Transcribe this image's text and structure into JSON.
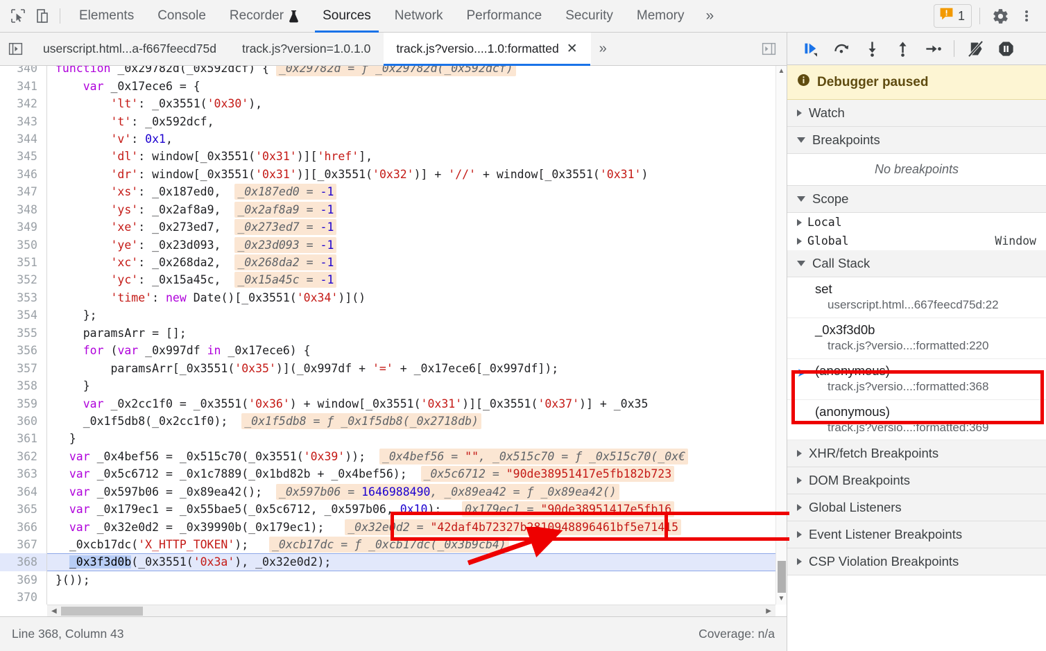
{
  "toolbar": {
    "inspect_icon": "inspect-cursor-icon",
    "device_icon": "device-toolbar-icon",
    "panels": [
      {
        "label": "Elements",
        "selected": false
      },
      {
        "label": "Console",
        "selected": false
      },
      {
        "label": "Recorder",
        "selected": false,
        "badge_icon": "flask-icon"
      },
      {
        "label": "Sources",
        "selected": true
      },
      {
        "label": "Network",
        "selected": false
      },
      {
        "label": "Performance",
        "selected": false
      },
      {
        "label": "Security",
        "selected": false
      },
      {
        "label": "Memory",
        "selected": false
      }
    ],
    "more_panels": "»",
    "warning_count": "1",
    "warning_icon": "warning-message-icon",
    "settings_icon": "gear-icon",
    "kebab_icon": "more-options-icon"
  },
  "file_tabs": {
    "nav_icon": "show-navigator-icon",
    "tabs": [
      {
        "label": "userscript.html...a-f667feecd75d",
        "active": false,
        "closable": false
      },
      {
        "label": "track.js?version=1.0.1.0",
        "active": false,
        "closable": false
      },
      {
        "label": "track.js?versio....1.0:formatted",
        "active": true,
        "closable": true,
        "close_glyph": "✕"
      }
    ],
    "more_glyph": "»",
    "right_panel_icon": "show-debugger-sidebar-icon"
  },
  "editor": {
    "first_line": 340,
    "exec_line": 368,
    "selected_token": "_0x3f3d0b",
    "lines": [
      {
        "n": 340,
        "clipped": true,
        "tokens": [
          {
            "t": "kw",
            "v": "function "
          },
          {
            "t": "fn",
            "v": "_0x29782d"
          },
          {
            "t": "pln",
            "v": "("
          },
          {
            "t": "pln",
            "v": "_0x592dcf"
          },
          {
            "t": "pln",
            "v": ") { "
          },
          {
            "t": "inline",
            "v": "_0x29782d = ƒ _0x29782d(_0x592dcf)"
          }
        ]
      },
      {
        "n": 341,
        "tokens": [
          {
            "t": "pln",
            "v": "    "
          },
          {
            "t": "kw",
            "v": "var"
          },
          {
            "t": "pln",
            "v": " _0x17ece6 = {"
          }
        ]
      },
      {
        "n": 342,
        "tokens": [
          {
            "t": "pln",
            "v": "        "
          },
          {
            "t": "str",
            "v": "'lt'"
          },
          {
            "t": "pln",
            "v": ": _0x3551("
          },
          {
            "t": "str",
            "v": "'0x30'"
          },
          {
            "t": "pln",
            "v": "),"
          }
        ]
      },
      {
        "n": 343,
        "tokens": [
          {
            "t": "pln",
            "v": "        "
          },
          {
            "t": "str",
            "v": "'t'"
          },
          {
            "t": "pln",
            "v": ": _0x592dcf,"
          }
        ]
      },
      {
        "n": 344,
        "tokens": [
          {
            "t": "pln",
            "v": "        "
          },
          {
            "t": "str",
            "v": "'v'"
          },
          {
            "t": "pln",
            "v": ": "
          },
          {
            "t": "num",
            "v": "0x1"
          },
          {
            "t": "pln",
            "v": ","
          }
        ]
      },
      {
        "n": 345,
        "tokens": [
          {
            "t": "pln",
            "v": "        "
          },
          {
            "t": "str",
            "v": "'dl'"
          },
          {
            "t": "pln",
            "v": ": window[_0x3551("
          },
          {
            "t": "str",
            "v": "'0x31'"
          },
          {
            "t": "pln",
            "v": ")]["
          },
          {
            "t": "str",
            "v": "'href'"
          },
          {
            "t": "pln",
            "v": "],"
          }
        ]
      },
      {
        "n": 346,
        "tokens": [
          {
            "t": "pln",
            "v": "        "
          },
          {
            "t": "str",
            "v": "'dr'"
          },
          {
            "t": "pln",
            "v": ": window[_0x3551("
          },
          {
            "t": "str",
            "v": "'0x31'"
          },
          {
            "t": "pln",
            "v": ")][_0x3551("
          },
          {
            "t": "str",
            "v": "'0x32'"
          },
          {
            "t": "pln",
            "v": ")] + "
          },
          {
            "t": "str",
            "v": "'//'"
          },
          {
            "t": "pln",
            "v": " + window[_0x3551("
          },
          {
            "t": "str",
            "v": "'0x31'"
          },
          {
            "t": "pln",
            "v": ")"
          }
        ]
      },
      {
        "n": 347,
        "tokens": [
          {
            "t": "pln",
            "v": "        "
          },
          {
            "t": "str",
            "v": "'xs'"
          },
          {
            "t": "pln",
            "v": ": _0x187ed0,  "
          },
          {
            "t": "inline",
            "v": "_0x187ed0 = ",
            "num": "-1"
          }
        ]
      },
      {
        "n": 348,
        "tokens": [
          {
            "t": "pln",
            "v": "        "
          },
          {
            "t": "str",
            "v": "'ys'"
          },
          {
            "t": "pln",
            "v": ": _0x2af8a9,  "
          },
          {
            "t": "inline",
            "v": "_0x2af8a9 = ",
            "num": "-1"
          }
        ]
      },
      {
        "n": 349,
        "tokens": [
          {
            "t": "pln",
            "v": "        "
          },
          {
            "t": "str",
            "v": "'xe'"
          },
          {
            "t": "pln",
            "v": ": _0x273ed7,  "
          },
          {
            "t": "inline",
            "v": "_0x273ed7 = ",
            "num": "-1"
          }
        ]
      },
      {
        "n": 350,
        "tokens": [
          {
            "t": "pln",
            "v": "        "
          },
          {
            "t": "str",
            "v": "'ye'"
          },
          {
            "t": "pln",
            "v": ": _0x23d093,  "
          },
          {
            "t": "inline",
            "v": "_0x23d093 = ",
            "num": "-1"
          }
        ]
      },
      {
        "n": 351,
        "tokens": [
          {
            "t": "pln",
            "v": "        "
          },
          {
            "t": "str",
            "v": "'xc'"
          },
          {
            "t": "pln",
            "v": ": _0x268da2,  "
          },
          {
            "t": "inline",
            "v": "_0x268da2 = ",
            "num": "-1"
          }
        ]
      },
      {
        "n": 352,
        "tokens": [
          {
            "t": "pln",
            "v": "        "
          },
          {
            "t": "str",
            "v": "'yc'"
          },
          {
            "t": "pln",
            "v": ": _0x15a45c,  "
          },
          {
            "t": "inline",
            "v": "_0x15a45c = ",
            "num": "-1"
          }
        ]
      },
      {
        "n": 353,
        "tokens": [
          {
            "t": "pln",
            "v": "        "
          },
          {
            "t": "str",
            "v": "'time'"
          },
          {
            "t": "pln",
            "v": ": "
          },
          {
            "t": "kw",
            "v": "new"
          },
          {
            "t": "pln",
            "v": " Date()[_0x3551("
          },
          {
            "t": "str",
            "v": "'0x34'"
          },
          {
            "t": "pln",
            "v": ")]()"
          }
        ]
      },
      {
        "n": 354,
        "tokens": [
          {
            "t": "pln",
            "v": "    };"
          }
        ]
      },
      {
        "n": 355,
        "tokens": [
          {
            "t": "pln",
            "v": "    paramsArr = [];"
          }
        ]
      },
      {
        "n": 356,
        "tokens": [
          {
            "t": "pln",
            "v": "    "
          },
          {
            "t": "kw",
            "v": "for"
          },
          {
            "t": "pln",
            "v": " ("
          },
          {
            "t": "kw",
            "v": "var"
          },
          {
            "t": "pln",
            "v": " _0x997df "
          },
          {
            "t": "kw",
            "v": "in"
          },
          {
            "t": "pln",
            "v": " _0x17ece6) {"
          }
        ]
      },
      {
        "n": 357,
        "tokens": [
          {
            "t": "pln",
            "v": "        paramsArr[_0x3551("
          },
          {
            "t": "str",
            "v": "'0x35'"
          },
          {
            "t": "pln",
            "v": ")](_0x997df + "
          },
          {
            "t": "str",
            "v": "'='"
          },
          {
            "t": "pln",
            "v": " + _0x17ece6[_0x997df]);"
          }
        ]
      },
      {
        "n": 358,
        "tokens": [
          {
            "t": "pln",
            "v": "    }"
          }
        ]
      },
      {
        "n": 359,
        "tokens": [
          {
            "t": "pln",
            "v": "    "
          },
          {
            "t": "kw",
            "v": "var"
          },
          {
            "t": "pln",
            "v": " _0x2cc1f0 = _0x3551("
          },
          {
            "t": "str",
            "v": "'0x36'"
          },
          {
            "t": "pln",
            "v": ") + window[_0x3551("
          },
          {
            "t": "str",
            "v": "'0x31'"
          },
          {
            "t": "pln",
            "v": ")][_0x3551("
          },
          {
            "t": "str",
            "v": "'0x37'"
          },
          {
            "t": "pln",
            "v": ")] + _0x35"
          }
        ]
      },
      {
        "n": 360,
        "tokens": [
          {
            "t": "pln",
            "v": "    _0x1f5db8(_0x2cc1f0);  "
          },
          {
            "t": "inline",
            "v": "_0x1f5db8 = ƒ _0x1f5db8(_0x2718db)"
          }
        ]
      },
      {
        "n": 361,
        "tokens": [
          {
            "t": "pln",
            "v": "  }"
          }
        ]
      },
      {
        "n": 362,
        "tokens": [
          {
            "t": "pln",
            "v": "  "
          },
          {
            "t": "kw",
            "v": "var"
          },
          {
            "t": "pln",
            "v": " _0x4bef56 = _0x515c70(_0x3551("
          },
          {
            "t": "str",
            "v": "'0x39'"
          },
          {
            "t": "pln",
            "v": "));  "
          },
          {
            "t": "inline",
            "v": "_0x4bef56 = ",
            "str": "\"\"",
            "tail": ", _0x515c70 = ƒ _0x515c70(_0x€"
          }
        ]
      },
      {
        "n": 363,
        "tokens": [
          {
            "t": "pln",
            "v": "  "
          },
          {
            "t": "kw",
            "v": "var"
          },
          {
            "t": "pln",
            "v": " _0x5c6712 = _0x1c7889(_0x1bd82b + _0x4bef56);  "
          },
          {
            "t": "inline",
            "v": "_0x5c6712 = ",
            "str": "\"90de38951417e5fb182b723"
          }
        ]
      },
      {
        "n": 364,
        "tokens": [
          {
            "t": "pln",
            "v": "  "
          },
          {
            "t": "kw",
            "v": "var"
          },
          {
            "t": "pln",
            "v": " _0x597b06 = _0x89ea42();  "
          },
          {
            "t": "inline",
            "v": "_0x597b06 = ",
            "num": "1646988490",
            "tail": ", _0x89ea42 = ƒ _0x89ea42()"
          }
        ]
      },
      {
        "n": 365,
        "tokens": [
          {
            "t": "pln",
            "v": "  "
          },
          {
            "t": "kw",
            "v": "var"
          },
          {
            "t": "pln",
            "v": " _0x179ec1 = _0x55bae5(_0x5c6712, _0x597b06, "
          },
          {
            "t": "num",
            "v": "0x10"
          },
          {
            "t": "pln",
            "v": ");   "
          },
          {
            "t": "inline",
            "v": "0x179ec1 = ",
            "str": "\"90de38951417e5fb16"
          }
        ]
      },
      {
        "n": 366,
        "tokens": [
          {
            "t": "pln",
            "v": "  "
          },
          {
            "t": "kw",
            "v": "var"
          },
          {
            "t": "pln",
            "v": " _0x32e0d2 = _0x39990b(_0x179ec1);   "
          },
          {
            "t": "inline",
            "v": "_0x32e0d2 = ",
            "str": "\"42daf4b72327b2810948896461bf5e71415"
          }
        ]
      },
      {
        "n": 367,
        "tokens": [
          {
            "t": "pln",
            "v": "  _0xcb17dc("
          },
          {
            "t": "str",
            "v": "'X_HTTP_TOKEN'"
          },
          {
            "t": "pln",
            "v": ");   "
          },
          {
            "t": "inline",
            "v": "_0xcb17dc = ƒ _0xcb17dc(_0x3b9cb4)"
          }
        ]
      },
      {
        "n": 368,
        "exec": true,
        "tokens": [
          {
            "t": "pln",
            "v": "  "
          },
          {
            "t": "sel",
            "v": "_0x3f3d0b"
          },
          {
            "t": "pln",
            "v": "(_0x3551("
          },
          {
            "t": "str",
            "v": "'0x3a'"
          },
          {
            "t": "pln",
            "v": "), _0x32e0d2);"
          }
        ]
      },
      {
        "n": 369,
        "tokens": [
          {
            "t": "pln",
            "v": "}());"
          }
        ]
      },
      {
        "n": 370,
        "tokens": [
          {
            "t": "pln",
            "v": ""
          }
        ]
      }
    ]
  },
  "status_bar": {
    "cursor_position": "Line 368, Column 43",
    "coverage": "Coverage: n/a"
  },
  "debugger": {
    "controls": [
      {
        "name": "resume-script-execution",
        "icon": "resume-icon"
      },
      {
        "name": "step-over-next-function-call",
        "icon": "step-over-icon"
      },
      {
        "name": "step-into-next-function-call",
        "icon": "step-into-icon"
      },
      {
        "name": "step-out-of-current-function",
        "icon": "step-out-icon"
      },
      {
        "name": "step",
        "icon": "step-icon"
      },
      {
        "name": "deactivate-breakpoints",
        "icon": "deactivate-breakpoints-icon"
      },
      {
        "name": "pause-on-exceptions",
        "icon": "pause-on-exceptions-icon"
      }
    ],
    "paused_banner": {
      "icon": "info-icon",
      "text": "Debugger paused"
    },
    "sections": [
      {
        "id": "watch",
        "title": "Watch",
        "expanded": false
      },
      {
        "id": "breakpoints",
        "title": "Breakpoints",
        "expanded": true,
        "empty_text": "No breakpoints"
      },
      {
        "id": "scope",
        "title": "Scope",
        "expanded": true
      },
      {
        "id": "callstack",
        "title": "Call Stack",
        "expanded": true
      },
      {
        "id": "xhr-fetch-breakpoints",
        "title": "XHR/fetch Breakpoints",
        "expanded": false
      },
      {
        "id": "dom-breakpoints",
        "title": "DOM Breakpoints",
        "expanded": false
      },
      {
        "id": "global-listeners",
        "title": "Global Listeners",
        "expanded": false
      },
      {
        "id": "event-listener-breakpoints",
        "title": "Event Listener Breakpoints",
        "expanded": false
      },
      {
        "id": "csp-violation-breakpoints",
        "title": "CSP Violation Breakpoints",
        "expanded": false
      }
    ],
    "scope_rows": [
      {
        "name": "Local",
        "value": ""
      },
      {
        "name": "Global",
        "value": "Window"
      }
    ],
    "call_stack": [
      {
        "fn": "set",
        "loc": "userscript.html...667feecd75d:22",
        "current": false
      },
      {
        "fn": "_0x3f3d0b",
        "loc": "track.js?versio...:formatted:220",
        "current": false
      },
      {
        "fn": "(anonymous)",
        "loc": "track.js?versio...:formatted:368",
        "current": true
      },
      {
        "fn": "(anonymous)",
        "loc": "track.js?versio...:formatted:369",
        "current": false
      }
    ]
  },
  "annotations": {
    "box_color": "#ee0000",
    "arrow_color": "#ee0000",
    "boxes": [
      {
        "name": "highlight-callstack-frame"
      },
      {
        "name": "highlight-token-value"
      }
    ]
  }
}
